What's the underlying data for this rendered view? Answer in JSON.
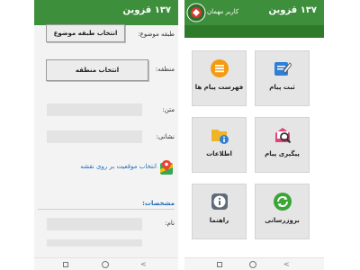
{
  "left_screen": {
    "title": "۱۳۷ قزوین",
    "form": {
      "subject_label": "طبقه موضوع:",
      "subject_button": "انتخاب طبقه موضوع",
      "region_label": "منطقه:",
      "region_button": "انتخاب منطقه",
      "text_label": "متن:",
      "address_label": "نشانی:",
      "map_link": "انتخاب موقعیت بر روی نقشه",
      "details_header": "مشخصات:",
      "name_label": "نام:"
    }
  },
  "right_screen": {
    "title": "۱۳۷ قزوین",
    "user_label": "کاربر مهمان",
    "tiles": [
      {
        "label": "ثبت پیام",
        "icon": "edit-message-icon"
      },
      {
        "label": "فهرست پیام ها",
        "icon": "message-list-icon"
      },
      {
        "label": "پیگیری پیام",
        "icon": "track-message-icon"
      },
      {
        "label": "اطلاعات",
        "icon": "folder-info-icon"
      },
      {
        "label": "بروزرسانی",
        "icon": "refresh-icon"
      },
      {
        "label": "راهنما",
        "icon": "help-info-icon"
      }
    ]
  },
  "colors": {
    "appbar_green": "#3e8f3c",
    "link_blue": "#1e6fc0",
    "section_header_blue": "#1e6fc0"
  }
}
